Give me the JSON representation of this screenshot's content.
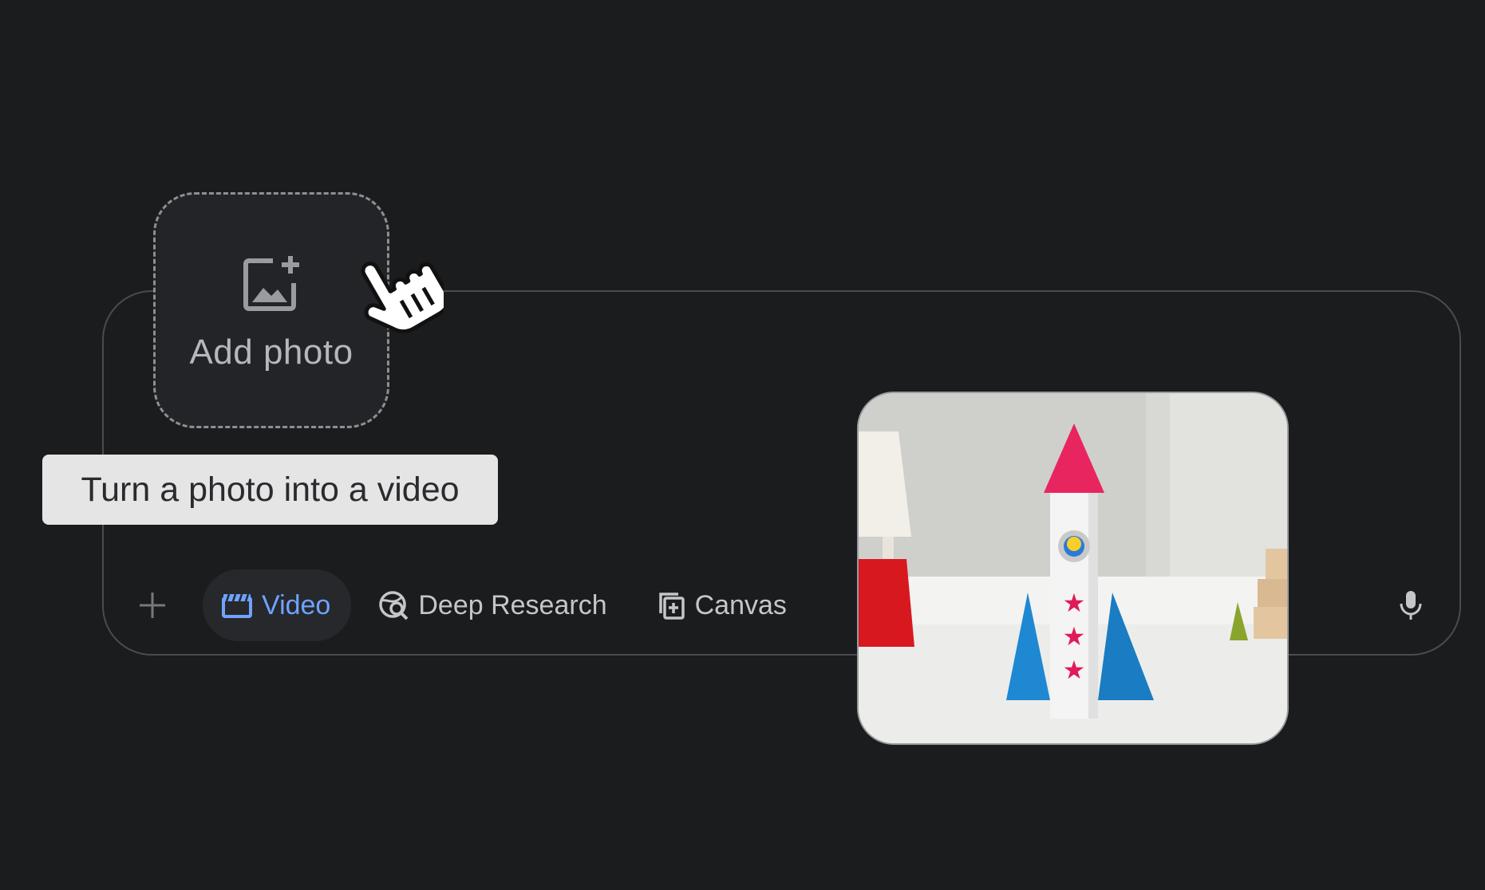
{
  "add_photo": {
    "label": "Add photo",
    "icon": "add-photo-icon"
  },
  "tooltip": {
    "text": "Turn a photo into a video"
  },
  "toolbar": {
    "plus_icon": "plus-icon",
    "chips": [
      {
        "label": "Video",
        "icon": "video-clapper-icon",
        "active": true
      },
      {
        "label": "Deep Research",
        "icon": "deep-research-icon",
        "active": false
      },
      {
        "label": "Canvas",
        "icon": "canvas-icon",
        "active": false
      }
    ],
    "mic_icon": "microphone-icon"
  },
  "colors": {
    "background": "#1b1c1e",
    "accent": "#6fa3ff",
    "tooltip_bg": "#e5e5e5"
  }
}
